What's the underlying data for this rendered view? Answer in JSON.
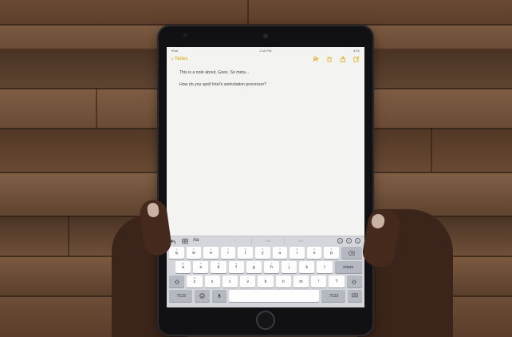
{
  "status": {
    "carrier": "iPad",
    "time": "2:15 PM",
    "battery": "47%"
  },
  "nav": {
    "back_label": "Notes"
  },
  "note": {
    "line1": "This is a note about. Goes. So meta...",
    "line2": "How do you spell Intel's workstation processor?"
  },
  "keyboard": {
    "shortcuts_left": [
      "undo-icon",
      "redo-icon",
      "table-icon"
    ],
    "format_label": "Aa",
    "predictions": [
      "I",
      "The",
      "I'm"
    ],
    "shortcuts_right": [
      "checklist-icon",
      "add-icon",
      "close-icon"
    ],
    "row1": [
      {
        "main": "q",
        "hint": "1"
      },
      {
        "main": "w",
        "hint": "2"
      },
      {
        "main": "e",
        "hint": "3"
      },
      {
        "main": "r",
        "hint": "4"
      },
      {
        "main": "t",
        "hint": "5"
      },
      {
        "main": "y",
        "hint": "6"
      },
      {
        "main": "u",
        "hint": "7"
      },
      {
        "main": "i",
        "hint": "8"
      },
      {
        "main": "o",
        "hint": "9"
      },
      {
        "main": "p",
        "hint": "0"
      }
    ],
    "delete_icon": "delete-icon",
    "row2": [
      {
        "main": "a",
        "hint": "@"
      },
      {
        "main": "s",
        "hint": "#"
      },
      {
        "main": "d",
        "hint": "$"
      },
      {
        "main": "f",
        "hint": "&"
      },
      {
        "main": "g",
        "hint": "*"
      },
      {
        "main": "h",
        "hint": "("
      },
      {
        "main": "j",
        "hint": ")"
      },
      {
        "main": "k",
        "hint": "'"
      },
      {
        "main": "l",
        "hint": "\""
      }
    ],
    "return_label": "return",
    "row3": [
      {
        "main": "z",
        "hint": "%"
      },
      {
        "main": "x",
        "hint": "-"
      },
      {
        "main": "c",
        "hint": "+"
      },
      {
        "main": "v",
        "hint": "="
      },
      {
        "main": "b",
        "hint": "/"
      },
      {
        "main": "n",
        "hint": ";"
      },
      {
        "main": "m",
        "hint": ":"
      },
      {
        "main": "!",
        "hint": ","
      },
      {
        "main": "?",
        "hint": "."
      }
    ],
    "numbers_label": ".?123",
    "space_label": ""
  }
}
